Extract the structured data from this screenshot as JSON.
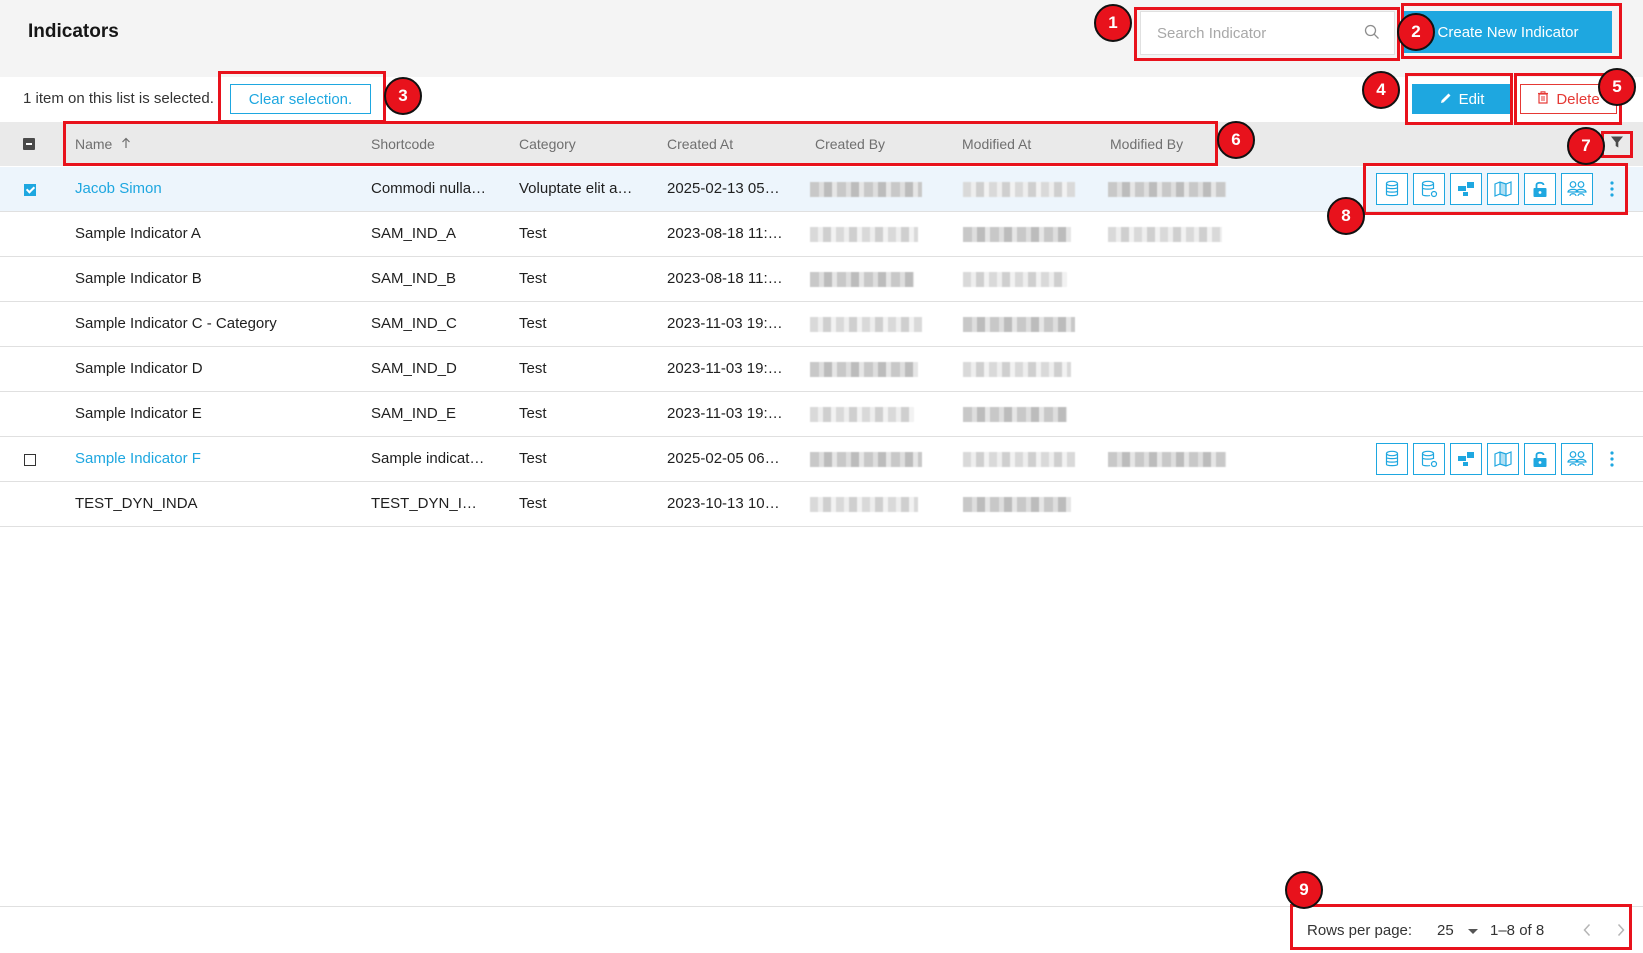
{
  "header": {
    "title": "Indicators",
    "search_placeholder": "Search Indicator",
    "create_label": "Create New Indicator"
  },
  "selection": {
    "text": "1 item on this list is selected.",
    "clear_label": "Clear selection.",
    "edit_label": "Edit",
    "delete_label": "Delete"
  },
  "table": {
    "columns": [
      "Name",
      "Shortcode",
      "Category",
      "Created At",
      "Created By",
      "Modified At",
      "Modified By"
    ],
    "sort_column": "Name",
    "rows": [
      {
        "name": "Jacob Simon",
        "shortcode": "Commodi nulla…",
        "category": "Voluptate elit a…",
        "created_at": "2025-02-13 05…",
        "link": true,
        "checkbox": "checked",
        "actions": true,
        "modified_by": true
      },
      {
        "name": "Sample Indicator A",
        "shortcode": "SAM_IND_A",
        "category": "Test",
        "created_at": "2023-08-18 11:…",
        "link": false,
        "checkbox": "none",
        "actions": false,
        "modified_by": true
      },
      {
        "name": "Sample Indicator B",
        "shortcode": "SAM_IND_B",
        "category": "Test",
        "created_at": "2023-08-18 11:…",
        "link": false,
        "checkbox": "none",
        "actions": false,
        "modified_by": false
      },
      {
        "name": "Sample Indicator C - Category",
        "shortcode": "SAM_IND_C",
        "category": "Test",
        "created_at": "2023-11-03 19:…",
        "link": false,
        "checkbox": "none",
        "actions": false,
        "modified_by": false
      },
      {
        "name": "Sample Indicator D",
        "shortcode": "SAM_IND_D",
        "category": "Test",
        "created_at": "2023-11-03 19:…",
        "link": false,
        "checkbox": "none",
        "actions": false,
        "modified_by": false
      },
      {
        "name": "Sample Indicator E",
        "shortcode": "SAM_IND_E",
        "category": "Test",
        "created_at": "2023-11-03 19:…",
        "link": false,
        "checkbox": "none",
        "actions": false,
        "modified_by": false
      },
      {
        "name": "Sample Indicator F",
        "shortcode": "Sample indicat…",
        "category": "Test",
        "created_at": "2025-02-05 06…",
        "link": true,
        "checkbox": "unchecked",
        "actions": true,
        "modified_by": true
      },
      {
        "name": "TEST_DYN_INDA",
        "shortcode": "TEST_DYN_I…",
        "category": "Test",
        "created_at": "2023-10-13 10…",
        "link": false,
        "checkbox": "none",
        "actions": false,
        "modified_by": false
      }
    ],
    "row_actions": [
      "database-icon",
      "database-settings-icon",
      "widget-icon",
      "map-icon",
      "unlock-icon",
      "users-icon",
      "more-vertical-icon"
    ]
  },
  "pagination": {
    "rows_per_page_label": "Rows per page:",
    "rows_per_page": "25",
    "range": "1–8 of 8"
  },
  "annotations": [
    "1",
    "2",
    "3",
    "4",
    "5",
    "6",
    "7",
    "8",
    "9"
  ],
  "colors": {
    "accent": "#1ea7e0",
    "danger": "#e53935",
    "annotation": "#e8121c"
  }
}
